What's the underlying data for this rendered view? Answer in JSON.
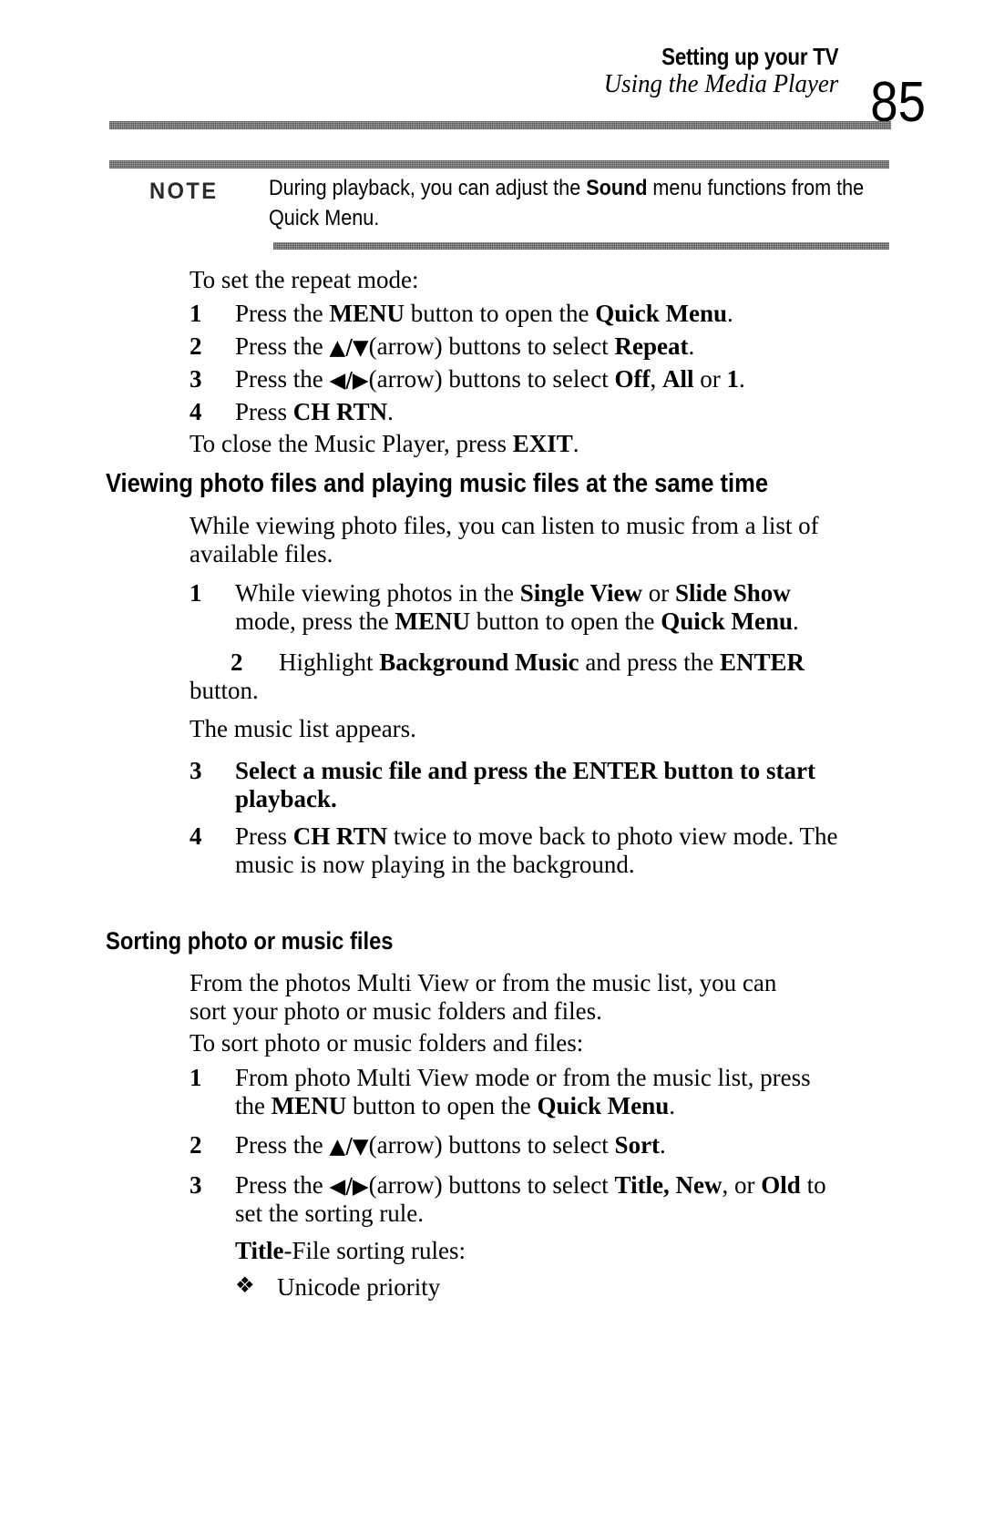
{
  "header": {
    "title": "Setting up your TV",
    "subtitle": "Using the Media Player",
    "page_number": "85"
  },
  "note": {
    "label": "NOTE",
    "text_before": "During playback, you can adjust the ",
    "text_bold": "Sound",
    "text_after": " menu functions from the Quick Menu."
  },
  "repeat_section": {
    "intro": "To set the repeat mode:",
    "steps": [
      {
        "num": "1",
        "text": "Press the MENU button to open the Quick Menu."
      },
      {
        "num": "2",
        "text": "Press the ▲/▼ (arrow) buttons to select Repeat."
      },
      {
        "num": "3",
        "text": "Press the ◀/▶ (arrow) buttons to select Off, All or 1."
      },
      {
        "num": "4",
        "text": "Press CH RTN."
      }
    ],
    "closing": "To close the Music Player, press EXIT."
  },
  "viewing_section": {
    "heading": "Viewing photo files and playing music files at the same time",
    "intro": "While viewing photo files, you can listen to music from a list of available files.",
    "step1": {
      "num": "1",
      "text": "While viewing photos in the Single View or Slide Show mode, press the MENU button to open the Quick Menu."
    },
    "step2": {
      "num": "2",
      "text": "Highlight Background Music and press the ENTER button."
    },
    "note_line": "The music list appears.",
    "step3": {
      "num": "3",
      "text": "Select a music file and press the ENTER button to start playback."
    },
    "step4": {
      "num": "4",
      "text": "Press CH RTN twice to move back to photo view mode. The music is now playing in the background."
    }
  },
  "sorting_section": {
    "heading": "Sorting photo or music files",
    "intro": "From the photos Multi View or from the music list, you can sort your photo or music folders and files.",
    "lead_in": "To sort photo or music folders and files:",
    "steps": [
      {
        "num": "1",
        "text": "From photo Multi View mode or from the music list, press the MENU button to open the Quick Menu."
      },
      {
        "num": "2",
        "text": "Press the ▲/▼ (arrow) buttons to select Sort."
      },
      {
        "num": "3",
        "text": "Press the ◀/▶ (arrow) buttons to select Title, New, or Old to set the sorting rule."
      }
    ],
    "rules_title_bold": "Title",
    "rules_title_rest": "-File sorting rules:",
    "bullet_glyph": "❖",
    "bullet_text": "Unicode priority"
  },
  "labels": {
    "menu": "MENU",
    "quick_menu": "Quick Menu",
    "repeat": "Repeat",
    "off": "Off",
    "all": "All",
    "one": "1",
    "ch_rtn": "CH RTN",
    "exit": "EXIT",
    "single_view": "Single View",
    "slide_show": "Slide Show",
    "background_music": "Background Music",
    "enter": "ENTER",
    "sort": "Sort",
    "title": "Title,",
    "new": "New",
    "old": "Old",
    "sound": "Sound"
  },
  "colors": {
    "text": "#000000",
    "rule": "#9a9a9a",
    "note_label": "#2b2b2b",
    "background": "#ffffff"
  }
}
